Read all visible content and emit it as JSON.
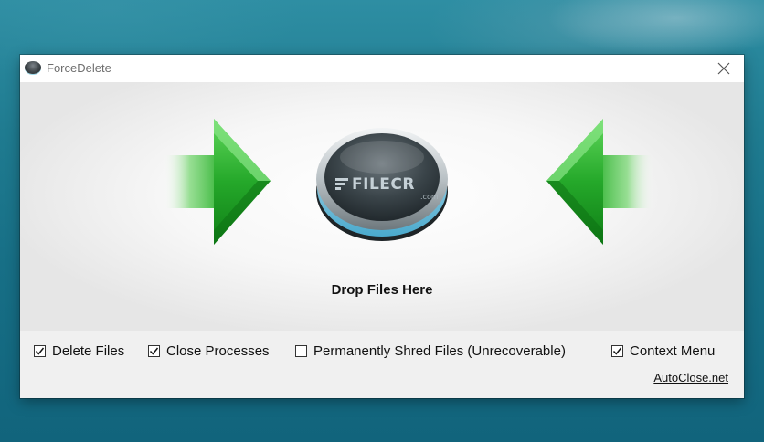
{
  "window": {
    "title": "ForceDelete",
    "icon": "app-disc-icon",
    "close_icon": "close-icon"
  },
  "drop_zone": {
    "label": "Drop Files Here",
    "left_arrow_icon": "arrow-right-icon",
    "right_arrow_icon": "arrow-left-icon",
    "button_icon": "drop-disc-icon",
    "watermark": {
      "text": "FILECR",
      "sub": ".com"
    }
  },
  "options": [
    {
      "label": "Delete Files",
      "checked": true
    },
    {
      "label": "Close Processes",
      "checked": true
    },
    {
      "label": "Permanently Shred Files (Unrecoverable)",
      "checked": false
    },
    {
      "label": "Context Menu",
      "checked": true
    }
  ],
  "footer": {
    "link": "AutoClose.net"
  },
  "colors": {
    "arrow_green": "#2fb52f",
    "arrow_dark": "#138a17",
    "disc_dark": "#2a3136",
    "disc_glow": "#7fd4ee",
    "options_bg": "#f0f0f0"
  }
}
